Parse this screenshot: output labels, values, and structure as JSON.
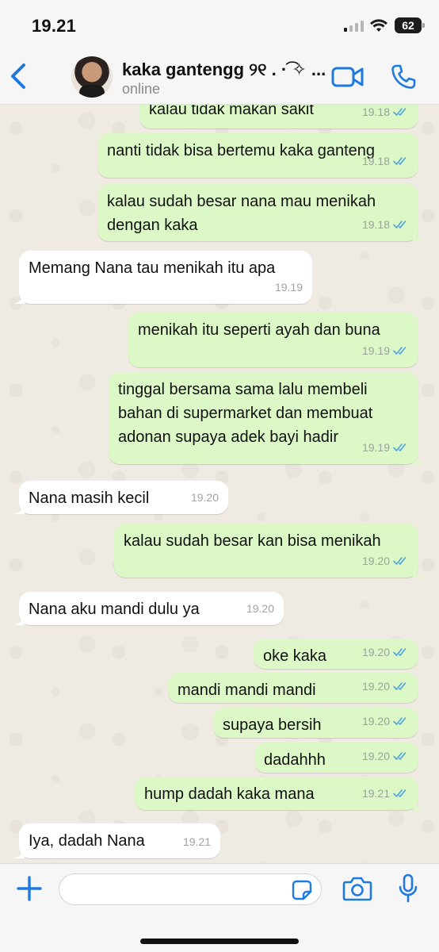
{
  "status_bar": {
    "time": "19.21",
    "battery": "62"
  },
  "header": {
    "contact_name": "kaka gantengg ୨୧ . ·͡ ✧ ...",
    "contact_status": "online"
  },
  "colors": {
    "accent": "#1f7ae0",
    "outgoing_bubble": "#dcf8c6",
    "incoming_bubble": "#ffffff",
    "read_ticks": "#4fa3e0"
  },
  "messages": [
    {
      "dir": "out",
      "text": "kalau tidak makan sakit",
      "time": "19.18",
      "read": true
    },
    {
      "dir": "out",
      "text": "nanti tidak bisa bertemu kaka ganteng",
      "time": "19.18",
      "read": true
    },
    {
      "dir": "out",
      "text": "kalau sudah besar nana mau menikah\ndengan kaka",
      "time": "19.18",
      "read": true
    },
    {
      "dir": "in",
      "text": "Memang Nana tau menikah itu apa",
      "time": "19.19"
    },
    {
      "dir": "out",
      "text": "menikah itu seperti ayah dan buna",
      "time": "19.19",
      "read": true
    },
    {
      "dir": "out",
      "text": "tinggal bersama sama lalu membeli\nbahan di supermarket dan membuat\nadonan supaya adek bayi hadir",
      "time": "19.19",
      "read": true
    },
    {
      "dir": "in",
      "text": "Nana masih kecil",
      "time": "19.20"
    },
    {
      "dir": "out",
      "text": "kalau sudah besar kan bisa menikah",
      "time": "19.20",
      "read": true
    },
    {
      "dir": "in",
      "text": "Nana aku mandi dulu ya",
      "time": "19.20"
    },
    {
      "dir": "out",
      "text": "oke kaka",
      "time": "19.20",
      "read": true
    },
    {
      "dir": "out",
      "text": "mandi mandi mandi",
      "time": "19.20",
      "read": true
    },
    {
      "dir": "out",
      "text": "supaya bersih",
      "time": "19.20",
      "read": true
    },
    {
      "dir": "out",
      "text": "dadahhh",
      "time": "19.20",
      "read": true
    },
    {
      "dir": "out",
      "text": "hump dadah kaka mana",
      "time": "19.21",
      "read": true
    },
    {
      "dir": "in",
      "text": "Iya, dadah Nana",
      "time": "19.21"
    }
  ],
  "input": {
    "placeholder": "",
    "value": ""
  }
}
